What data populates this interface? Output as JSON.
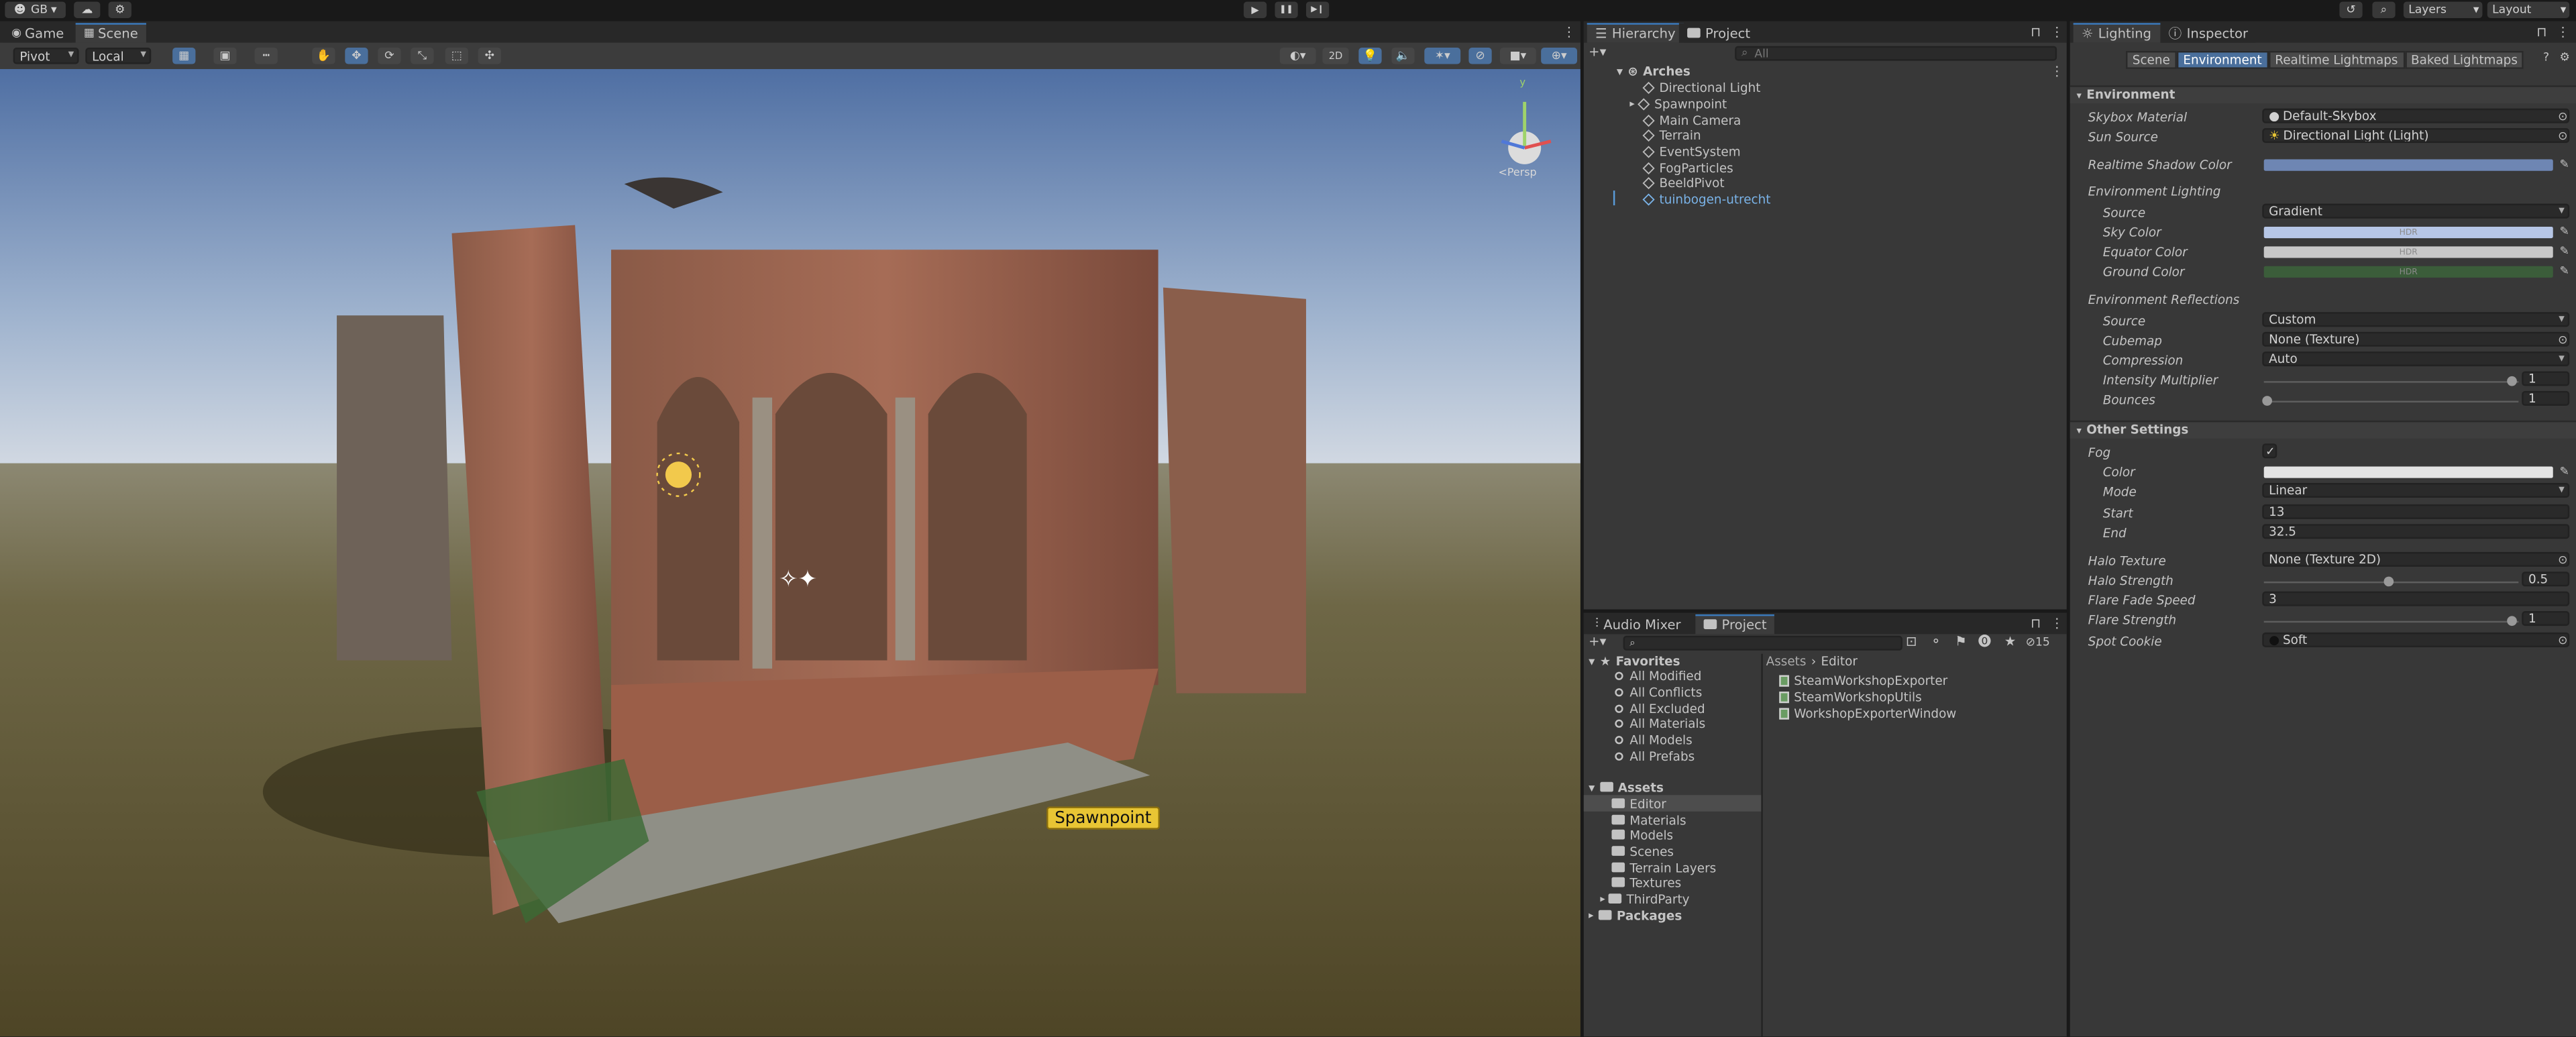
{
  "toolbar": {
    "account": "GB",
    "play": "▶",
    "pause": "❚❚",
    "step": "▶❙",
    "layers": "Layers",
    "layout": "Layout"
  },
  "scene_view": {
    "tabs": [
      "Game",
      "Scene"
    ],
    "pivot": "Pivot",
    "local": "Local",
    "mode_2d": "2D",
    "persp": "<Persp",
    "gizmo_y": "y",
    "spawn_label": "Spawnpoint"
  },
  "hierarchy": {
    "tabs": [
      "Hierarchy",
      "Project"
    ],
    "search_placeholder": "All",
    "root": "Arches",
    "items": [
      "Directional Light",
      "Spawnpoint",
      "Main Camera",
      "Terrain",
      "EventSystem",
      "FogParticles",
      "BeeldPivot",
      "tuinbogen-utrecht"
    ]
  },
  "project": {
    "tabs": [
      "Audio Mixer",
      "Project"
    ],
    "badge_count": "15",
    "favorites_label": "Favorites",
    "favorites": [
      "All Modified",
      "All Conflicts",
      "All Excluded",
      "All Materials",
      "All Models",
      "All Prefabs"
    ],
    "assets_label": "Assets",
    "assets": [
      "Editor",
      "Materials",
      "Models",
      "Scenes",
      "Terrain Layers",
      "Textures",
      "ThirdParty"
    ],
    "packages_label": "Packages",
    "breadcrumb_root": "Assets",
    "breadcrumb_current": "Editor",
    "files": [
      "SteamWorkshopExporter",
      "SteamWorkshopUtils",
      "WorkshopExporterWindow"
    ]
  },
  "lighting": {
    "tabs": [
      "Lighting",
      "Inspector"
    ],
    "sub_tabs": [
      "Scene",
      "Environment",
      "Realtime Lightmaps",
      "Baked Lightmaps"
    ],
    "environment_header": "Environment",
    "skybox_label": "Skybox Material",
    "skybox_value": "Default-Skybox",
    "sun_label": "Sun Source",
    "sun_value": "Directional Light (Light)",
    "shadow_label": "Realtime Shadow Color",
    "env_lighting_label": "Environment Lighting",
    "source_label": "Source",
    "source_value": "Gradient",
    "sky_label": "Sky Color",
    "equator_label": "Equator Color",
    "ground_label": "Ground Color",
    "hdr": "HDR",
    "env_reflections_label": "Environment Reflections",
    "refl_source_label": "Source",
    "refl_source_value": "Custom",
    "cubemap_label": "Cubemap",
    "cubemap_value": "None (Texture)",
    "compression_label": "Compression",
    "compression_value": "Auto",
    "intensity_label": "Intensity Multiplier",
    "intensity_value": "1",
    "bounces_label": "Bounces",
    "bounces_value": "1",
    "other_header": "Other Settings",
    "fog_label": "Fog",
    "fog_checked": "✓",
    "fog_color_label": "Color",
    "fog_mode_label": "Mode",
    "fog_mode_value": "Linear",
    "fog_start_label": "Start",
    "fog_start_value": "13",
    "fog_end_label": "End",
    "fog_end_value": "32.5",
    "halo_texture_label": "Halo Texture",
    "halo_texture_value": "None (Texture 2D)",
    "halo_strength_label": "Halo Strength",
    "halo_strength_value": "0.5",
    "flare_fade_label": "Flare Fade Speed",
    "flare_fade_value": "3",
    "flare_strength_label": "Flare Strength",
    "flare_strength_value": "1",
    "spot_cookie_label": "Spot Cookie",
    "spot_cookie_value": "Soft"
  },
  "colors": {
    "accent": "#3a79bb",
    "shadow": "#6e86b3",
    "sky": "#b6c6e6",
    "equator": "#c7c7c7",
    "ground": "#3b5d3a",
    "fog": "#e3e3e3"
  }
}
